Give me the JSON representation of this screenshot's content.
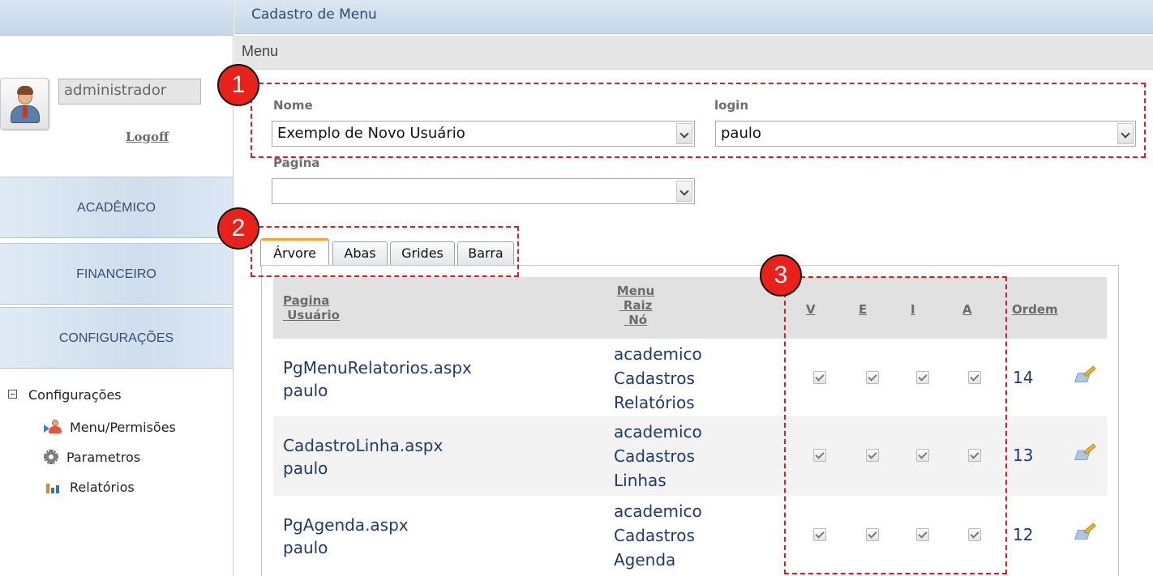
{
  "sidebar": {
    "username": "administrador",
    "logoff": "Logoff",
    "menu_buttons": [
      "ACADÊMICO",
      "FINANCEIRO",
      "CONFIGURAÇÕES"
    ],
    "tree": {
      "root": "Configurações",
      "items": [
        {
          "label": "Menu/Permisões",
          "icon": "user-arrow-icon"
        },
        {
          "label": "Parametros",
          "icon": "gear-icon"
        },
        {
          "label": "Relatórios",
          "icon": "bar-chart-icon"
        }
      ]
    }
  },
  "main": {
    "header_title": "Cadastro de Menu",
    "section_title": "Menu",
    "form": {
      "nome_label": "Nome",
      "nome_value": "Exemplo de Novo Usuário",
      "login_label": "login",
      "login_value": "paulo",
      "pagina_label": "Pagina",
      "pagina_value": ""
    },
    "tabs": [
      "Árvore",
      "Abas",
      "Grides",
      "Barra"
    ],
    "active_tab": "Árvore",
    "grid": {
      "headers": {
        "pagina": "Pagina",
        "usuario": "Usuário",
        "menu": "Menu",
        "raiz": "Raiz",
        "no": "Nó",
        "v": "V",
        "e": "E",
        "i": "I",
        "a": "A",
        "ordem": "Ordem"
      },
      "rows": [
        {
          "pagina": "PgMenuRelatorios.aspx",
          "usuario": "paulo",
          "menu": "academico",
          "raiz": "Cadastros",
          "no": "Relatórios",
          "v": true,
          "e": true,
          "i": true,
          "a": true,
          "ordem": "14"
        },
        {
          "pagina": "CadastroLinha.aspx",
          "usuario": "paulo",
          "menu": "academico",
          "raiz": "Cadastros",
          "no": "Linhas",
          "v": true,
          "e": true,
          "i": true,
          "a": true,
          "ordem": "13"
        },
        {
          "pagina": "PgAgenda.aspx",
          "usuario": "paulo",
          "menu": "academico",
          "raiz": "Cadastros",
          "no": "Agenda",
          "v": true,
          "e": true,
          "i": true,
          "a": true,
          "ordem": "12"
        }
      ]
    }
  },
  "annotations": [
    "1",
    "2",
    "3"
  ],
  "colors": {
    "annotation_red": "#e8221a",
    "link_blue": "#1f3a6b",
    "active_tab_accent": "#f2a43a"
  }
}
